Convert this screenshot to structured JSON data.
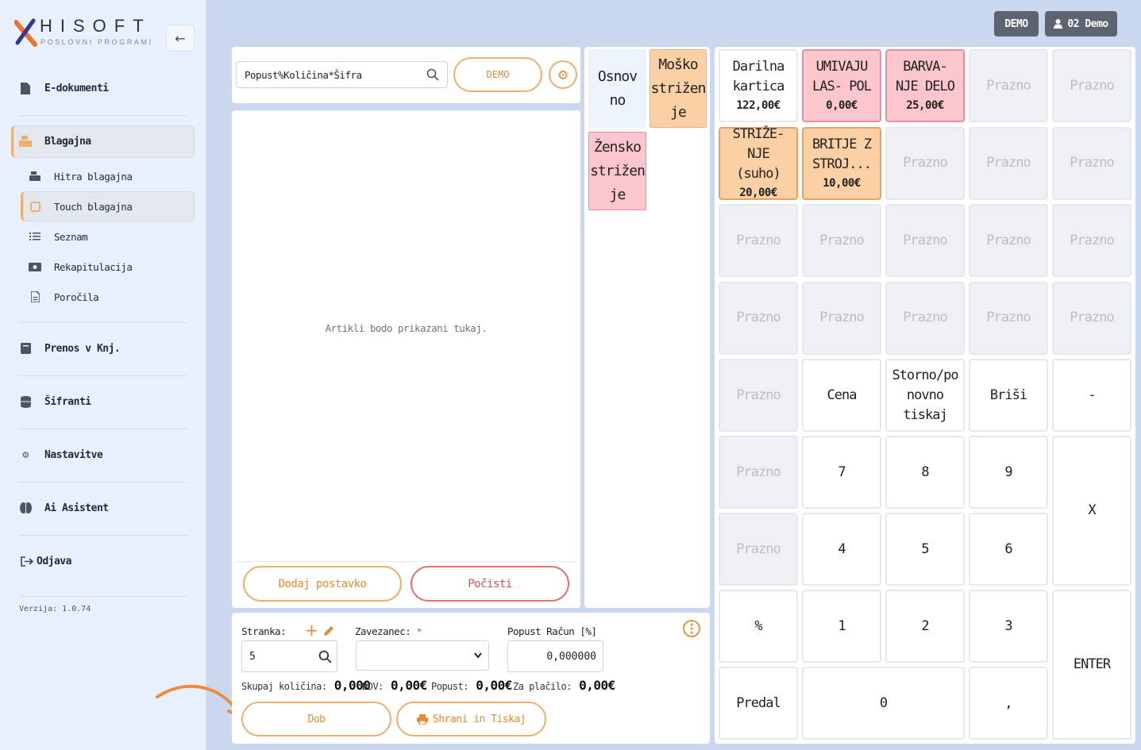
{
  "brand": {
    "name": "HISOFT",
    "tagline": "POSLOVNI PROGRAMI"
  },
  "top_badges": {
    "company": "DEMO",
    "user": "02 Demo"
  },
  "sidebar": {
    "items": [
      {
        "label": "E-dokumenti",
        "icon": "document-icon"
      },
      {
        "label": "Blagajna",
        "icon": "cash-register-icon"
      },
      {
        "label": "Prenos v Knj.",
        "icon": "book-icon"
      },
      {
        "label": "Šifranti",
        "icon": "database-icon"
      },
      {
        "label": "Nastavitve",
        "icon": "gear-icon"
      },
      {
        "label": "Ai Asistent",
        "icon": "brain-icon"
      },
      {
        "label": "Odjava",
        "icon": "logout-icon"
      }
    ],
    "sub_items": [
      {
        "label": "Hitra blagajna",
        "icon": "cash-register-icon"
      },
      {
        "label": "Touch blagajna",
        "icon": "tablet-icon"
      },
      {
        "label": "Seznam",
        "icon": "list-icon"
      },
      {
        "label": "Rekapitulacija",
        "icon": "money-icon"
      },
      {
        "label": "Poročila",
        "icon": "report-icon"
      }
    ],
    "version": "Verzija: 1.0.74"
  },
  "search": {
    "value": "Popust%Količina*Šifra",
    "demo_label": "DEMO"
  },
  "items_panel": {
    "placeholder": "Artikli bodo prikazani tukaj.",
    "add_label": "Dodaj postavko",
    "clear_label": "Počisti"
  },
  "categories": [
    {
      "label": "Osnov no",
      "style": "plain"
    },
    {
      "label": "Moško strižen je",
      "style": "orange"
    },
    {
      "label": "Žensko strižen je",
      "style": "pink"
    }
  ],
  "form": {
    "customer_label": "Stranka:",
    "customer_value": "5",
    "taxpayer_label": "Zavezanec:",
    "required_mark": "*",
    "discount_label": "Popust Račun [%]",
    "discount_value": "0,000000",
    "total_qty_label": "Skupaj količina:",
    "total_qty": "0,000",
    "vat_label": "DDV:",
    "vat": "0,00€",
    "discount_total_label": "Popust:",
    "discount_total": "0,00€",
    "pay_label": "Za plačilo:",
    "pay": "0,00€",
    "delivery_label": "Dob",
    "save_print_label": "Shrani in Tiskaj"
  },
  "products": [
    {
      "name": "Darilna kartica",
      "price": "122,00€",
      "style": "plain"
    },
    {
      "name": "UMIVAJU LAS- POL",
      "price": "0,00€",
      "style": "pink"
    },
    {
      "name": "BARVA- NJE DELO",
      "price": "25,00€",
      "style": "pink"
    },
    {
      "name": "Prazno",
      "style": "empty"
    },
    {
      "name": "Prazno",
      "style": "empty"
    },
    {
      "name": "STRIŽE- NJE (suho)",
      "price": "20,00€",
      "style": "orange"
    },
    {
      "name": "BRITJE Z STROJ...",
      "price": "10,00€",
      "style": "orange"
    },
    {
      "name": "Prazno",
      "style": "empty"
    },
    {
      "name": "Prazno",
      "style": "empty"
    },
    {
      "name": "Prazno",
      "style": "empty"
    },
    {
      "name": "Prazno",
      "style": "empty"
    },
    {
      "name": "Prazno",
      "style": "empty"
    },
    {
      "name": "Prazno",
      "style": "empty"
    },
    {
      "name": "Prazno",
      "style": "empty"
    },
    {
      "name": "Prazno",
      "style": "empty"
    },
    {
      "name": "Prazno",
      "style": "empty"
    },
    {
      "name": "Prazno",
      "style": "empty"
    },
    {
      "name": "Prazno",
      "style": "empty"
    },
    {
      "name": "Prazno",
      "style": "empty"
    },
    {
      "name": "Prazno",
      "style": "empty"
    }
  ],
  "keypad": {
    "empty_label": "Prazno",
    "price": "Cena",
    "storno": "Storno/po novno tiskaj",
    "delete": "Briši",
    "minus": "-",
    "seven": "7",
    "eight": "8",
    "nine": "9",
    "multiply": "X",
    "four": "4",
    "five": "5",
    "six": "6",
    "percent": "%",
    "one": "1",
    "two": "2",
    "three": "3",
    "enter": "ENTER",
    "drawer": "Predal",
    "zero": "0",
    "comma": ","
  }
}
